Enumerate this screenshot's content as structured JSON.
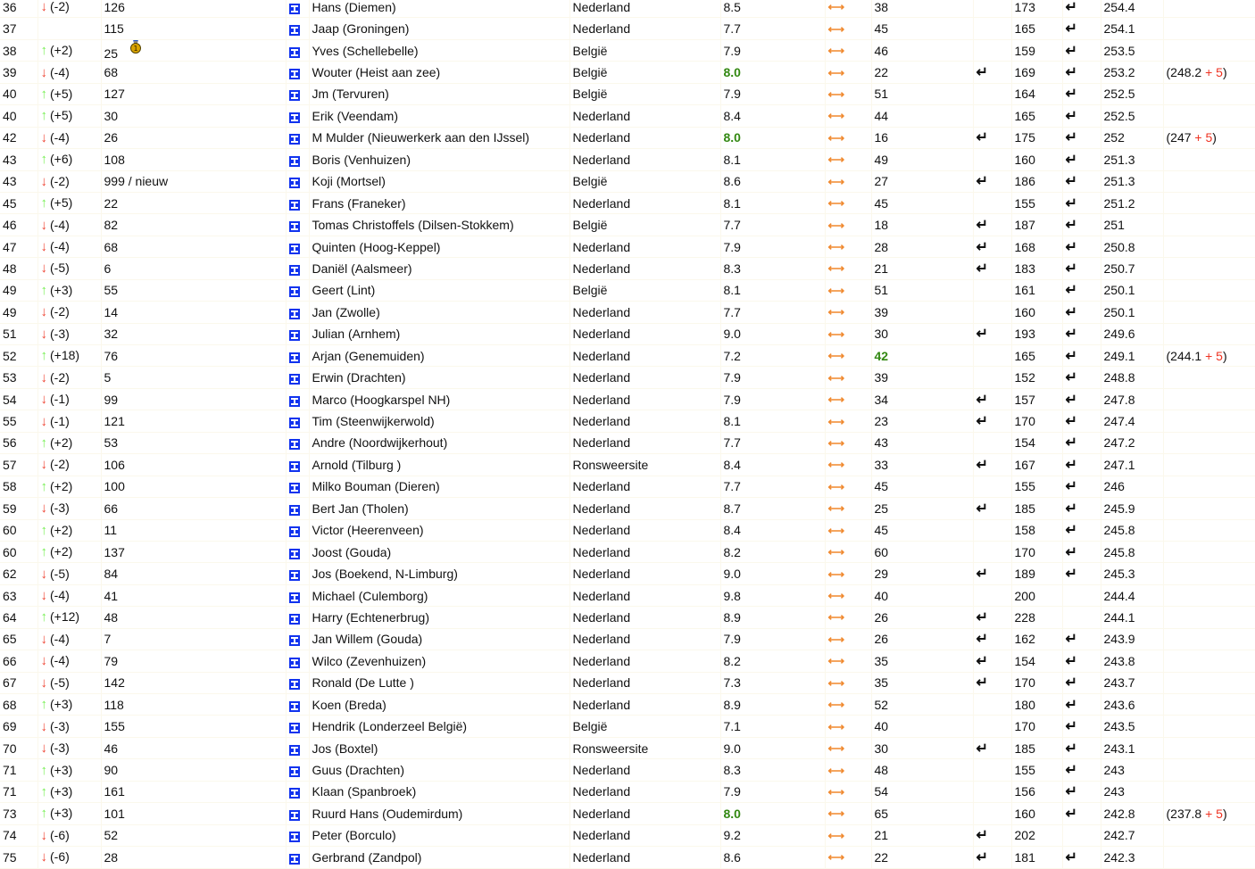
{
  "colors": {
    "down": "#ee4433",
    "up": "#77ee55",
    "green": "#338811",
    "swap": "#f08a30",
    "flag": "#1133ee"
  },
  "icons": {
    "down": "arrow-down-icon",
    "up": "arrow-up-icon",
    "flag": "player-icon",
    "swap": "swap-arrows-icon",
    "ret": "return-icon",
    "medal": "medal-icon"
  },
  "rows": [
    {
      "rank": "36",
      "dir": "down",
      "chg": "(-2)",
      "num": "126",
      "name": "Hans (Diemen)",
      "country": "Nederland",
      "score": "8.5",
      "v1": "38",
      "r1": false,
      "v2": "173",
      "r2": true,
      "total": "254.4"
    },
    {
      "rank": "37",
      "dir": "",
      "chg": "",
      "num": "115",
      "name": "Jaap (Groningen)",
      "country": "Nederland",
      "score": "7.7",
      "v1": "45",
      "r1": false,
      "v2": "165",
      "r2": true,
      "total": "254.1"
    },
    {
      "rank": "38",
      "dir": "up",
      "chg": "(+2)",
      "num": "25",
      "medal": true,
      "name": "Yves (Schellebelle)",
      "country": "België",
      "score": "7.9",
      "v1": "46",
      "r1": false,
      "v2": "159",
      "r2": true,
      "total": "253.5"
    },
    {
      "rank": "39",
      "dir": "down",
      "chg": "(-4)",
      "num": "68",
      "name": "Wouter (Heist aan zee)",
      "country": "België",
      "score": "8.0",
      "scoreGreen": true,
      "v1": "22",
      "r1": true,
      "v2": "169",
      "r2": true,
      "total": "253.2",
      "bonusBase": "248.2",
      "bonusPlus": "+ 5"
    },
    {
      "rank": "40",
      "dir": "up",
      "chg": "(+5)",
      "num": "127",
      "name": "Jm (Tervuren)",
      "country": "België",
      "score": "7.9",
      "v1": "51",
      "r1": false,
      "v2": "164",
      "r2": true,
      "total": "252.5"
    },
    {
      "rank": "40",
      "dir": "up",
      "chg": "(+5)",
      "num": "30",
      "name": "Erik (Veendam)",
      "country": "Nederland",
      "score": "8.4",
      "v1": "44",
      "r1": false,
      "v2": "165",
      "r2": true,
      "total": "252.5"
    },
    {
      "rank": "42",
      "dir": "down",
      "chg": "(-4)",
      "num": "26",
      "name": "M Mulder (Nieuwerkerk aan den IJssel)",
      "country": "Nederland",
      "score": "8.0",
      "scoreGreen": true,
      "v1": "16",
      "r1": true,
      "v2": "175",
      "r2": true,
      "total": "252",
      "bonusBase": "247",
      "bonusPlus": "+ 5"
    },
    {
      "rank": "43",
      "dir": "up",
      "chg": "(+6)",
      "num": "108",
      "name": "Boris (Venhuizen)",
      "country": "Nederland",
      "score": "8.1",
      "v1": "49",
      "r1": false,
      "v2": "160",
      "r2": true,
      "total": "251.3"
    },
    {
      "rank": "43",
      "dir": "down",
      "chg": "(-2)",
      "num": "999 / nieuw",
      "name": "Koji (Mortsel)",
      "country": "België",
      "score": "8.6",
      "v1": "27",
      "r1": true,
      "v2": "186",
      "r2": true,
      "total": "251.3"
    },
    {
      "rank": "45",
      "dir": "up",
      "chg": "(+5)",
      "num": "22",
      "name": "Frans (Franeker)",
      "country": "Nederland",
      "score": "8.1",
      "v1": "45",
      "r1": false,
      "v2": "155",
      "r2": true,
      "total": "251.2"
    },
    {
      "rank": "46",
      "dir": "down",
      "chg": "(-4)",
      "num": "82",
      "name": "Tomas Christoffels (Dilsen-Stokkem)",
      "country": "België",
      "score": "7.7",
      "v1": "18",
      "r1": true,
      "v2": "187",
      "r2": true,
      "total": "251"
    },
    {
      "rank": "47",
      "dir": "down",
      "chg": "(-4)",
      "num": "68",
      "name": "Quinten (Hoog-Keppel)",
      "country": "Nederland",
      "score": "7.9",
      "v1": "28",
      "r1": true,
      "v2": "168",
      "r2": true,
      "total": "250.8"
    },
    {
      "rank": "48",
      "dir": "down",
      "chg": "(-5)",
      "num": "6",
      "name": "Daniël (Aalsmeer)",
      "country": "Nederland",
      "score": "8.3",
      "v1": "21",
      "r1": true,
      "v2": "183",
      "r2": true,
      "total": "250.7"
    },
    {
      "rank": "49",
      "dir": "up",
      "chg": "(+3)",
      "num": "55",
      "name": "Geert (Lint)",
      "country": "België",
      "score": "8.1",
      "v1": "51",
      "r1": false,
      "v2": "161",
      "r2": true,
      "total": "250.1"
    },
    {
      "rank": "49",
      "dir": "down",
      "chg": "(-2)",
      "num": "14",
      "name": "Jan (Zwolle)",
      "country": "Nederland",
      "score": "7.7",
      "v1": "39",
      "r1": false,
      "v2": "160",
      "r2": true,
      "total": "250.1"
    },
    {
      "rank": "51",
      "dir": "down",
      "chg": "(-3)",
      "num": "32",
      "name": "Julian (Arnhem)",
      "country": "Nederland",
      "score": "9.0",
      "v1": "30",
      "r1": true,
      "v2": "193",
      "r2": true,
      "total": "249.6"
    },
    {
      "rank": "52",
      "dir": "up",
      "chg": "(+18)",
      "num": "76",
      "name": "Arjan (Genemuiden)",
      "country": "Nederland",
      "score": "7.2",
      "v1": "42",
      "v1Green": true,
      "r1": false,
      "v2": "165",
      "r2": true,
      "total": "249.1",
      "bonusBase": "244.1",
      "bonusPlus": "+ 5"
    },
    {
      "rank": "53",
      "dir": "down",
      "chg": "(-2)",
      "num": "5",
      "name": "Erwin (Drachten)",
      "country": "Nederland",
      "score": "7.9",
      "v1": "39",
      "r1": false,
      "v2": "152",
      "r2": true,
      "total": "248.8"
    },
    {
      "rank": "54",
      "dir": "down",
      "chg": "(-1)",
      "num": "99",
      "name": "Marco (Hoogkarspel NH)",
      "country": "Nederland",
      "score": "7.9",
      "v1": "34",
      "r1": true,
      "v2": "157",
      "r2": true,
      "total": "247.8"
    },
    {
      "rank": "55",
      "dir": "down",
      "chg": "(-1)",
      "num": "121",
      "name": "Tim (Steenwijkerwold)",
      "country": "Nederland",
      "score": "8.1",
      "v1": "23",
      "r1": true,
      "v2": "170",
      "r2": true,
      "total": "247.4"
    },
    {
      "rank": "56",
      "dir": "up",
      "chg": "(+2)",
      "num": "53",
      "name": "Andre (Noordwijkerhout)",
      "country": "Nederland",
      "score": "7.7",
      "v1": "43",
      "r1": false,
      "v2": "154",
      "r2": true,
      "total": "247.2"
    },
    {
      "rank": "57",
      "dir": "down",
      "chg": "(-2)",
      "num": "106",
      "name": "Arnold (Tilburg )",
      "country": "Ronsweersite",
      "score": "8.4",
      "v1": "33",
      "r1": true,
      "v2": "167",
      "r2": true,
      "total": "247.1"
    },
    {
      "rank": "58",
      "dir": "up",
      "chg": "(+2)",
      "num": "100",
      "name": "Milko Bouman (Dieren)",
      "country": "Nederland",
      "score": "7.7",
      "v1": "45",
      "r1": false,
      "v2": "155",
      "r2": true,
      "total": "246"
    },
    {
      "rank": "59",
      "dir": "down",
      "chg": "(-3)",
      "num": "66",
      "name": "Bert Jan (Tholen)",
      "country": "Nederland",
      "score": "8.7",
      "v1": "25",
      "r1": true,
      "v2": "185",
      "r2": true,
      "total": "245.9"
    },
    {
      "rank": "60",
      "dir": "up",
      "chg": "(+2)",
      "num": "11",
      "name": "Victor (Heerenveen)",
      "country": "Nederland",
      "score": "8.4",
      "v1": "45",
      "r1": false,
      "v2": "158",
      "r2": true,
      "total": "245.8"
    },
    {
      "rank": "60",
      "dir": "up",
      "chg": "(+2)",
      "num": "137",
      "name": "Joost (Gouda)",
      "country": "Nederland",
      "score": "8.2",
      "v1": "60",
      "r1": false,
      "v2": "170",
      "r2": true,
      "total": "245.8"
    },
    {
      "rank": "62",
      "dir": "down",
      "chg": "(-5)",
      "num": "84",
      "name": "Jos (Boekend, N-Limburg)",
      "country": "Nederland",
      "score": "9.0",
      "v1": "29",
      "r1": true,
      "v2": "189",
      "r2": true,
      "total": "245.3"
    },
    {
      "rank": "63",
      "dir": "down",
      "chg": "(-4)",
      "num": "41",
      "name": "Michael (Culemborg)",
      "country": "Nederland",
      "score": "9.8",
      "v1": "40",
      "r1": false,
      "v2": "200",
      "r2": false,
      "total": "244.4"
    },
    {
      "rank": "64",
      "dir": "up",
      "chg": "(+12)",
      "num": "48",
      "name": "Harry (Echtenerbrug)",
      "country": "Nederland",
      "score": "8.9",
      "v1": "26",
      "r1": true,
      "v2": "228",
      "r2": false,
      "total": "244.1"
    },
    {
      "rank": "65",
      "dir": "down",
      "chg": "(-4)",
      "num": "7",
      "name": "Jan Willem (Gouda)",
      "country": "Nederland",
      "score": "7.9",
      "v1": "26",
      "r1": true,
      "v2": "162",
      "r2": true,
      "total": "243.9"
    },
    {
      "rank": "66",
      "dir": "down",
      "chg": "(-4)",
      "num": "79",
      "name": "Wilco (Zevenhuizen)",
      "country": "Nederland",
      "score": "8.2",
      "v1": "35",
      "r1": true,
      "v2": "154",
      "r2": true,
      "total": "243.8"
    },
    {
      "rank": "67",
      "dir": "down",
      "chg": "(-5)",
      "num": "142",
      "name": "Ronald (De Lutte )",
      "country": "Nederland",
      "score": "7.3",
      "v1": "35",
      "r1": true,
      "v2": "170",
      "r2": true,
      "total": "243.7"
    },
    {
      "rank": "68",
      "dir": "up",
      "chg": "(+3)",
      "num": "118",
      "name": "Koen (Breda)",
      "country": "Nederland",
      "score": "8.9",
      "v1": "52",
      "r1": false,
      "v2": "180",
      "r2": true,
      "total": "243.6"
    },
    {
      "rank": "69",
      "dir": "down",
      "chg": "(-3)",
      "num": "155",
      "name": "Hendrik (Londerzeel België)",
      "country": "België",
      "score": "7.1",
      "v1": "40",
      "r1": false,
      "v2": "170",
      "r2": true,
      "total": "243.5"
    },
    {
      "rank": "70",
      "dir": "down",
      "chg": "(-3)",
      "num": "46",
      "name": "Jos (Boxtel)",
      "country": "Ronsweersite",
      "score": "9.0",
      "v1": "30",
      "r1": true,
      "v2": "185",
      "r2": true,
      "total": "243.1"
    },
    {
      "rank": "71",
      "dir": "up",
      "chg": "(+3)",
      "num": "90",
      "name": "Guus (Drachten)",
      "country": "Nederland",
      "score": "8.3",
      "v1": "48",
      "r1": false,
      "v2": "155",
      "r2": true,
      "total": "243"
    },
    {
      "rank": "71",
      "dir": "up",
      "chg": "(+3)",
      "num": "161",
      "name": "Klaan (Spanbroek)",
      "country": "Nederland",
      "score": "7.9",
      "v1": "54",
      "r1": false,
      "v2": "156",
      "r2": true,
      "total": "243"
    },
    {
      "rank": "73",
      "dir": "up",
      "chg": "(+3)",
      "num": "101",
      "name": "Ruurd Hans (Oudemirdum)",
      "country": "Nederland",
      "score": "8.0",
      "scoreGreen": true,
      "v1": "65",
      "r1": false,
      "v2": "160",
      "r2": true,
      "total": "242.8",
      "bonusBase": "237.8",
      "bonusPlus": "+ 5"
    },
    {
      "rank": "74",
      "dir": "down",
      "chg": "(-6)",
      "num": "52",
      "name": "Peter (Borculo)",
      "country": "Nederland",
      "score": "9.2",
      "v1": "21",
      "r1": true,
      "v2": "202",
      "r2": false,
      "total": "242.7"
    },
    {
      "rank": "75",
      "dir": "down",
      "chg": "(-6)",
      "num": "28",
      "name": "Gerbrand (Zandpol)",
      "country": "Nederland",
      "score": "8.6",
      "v1": "22",
      "r1": true,
      "v2": "181",
      "r2": true,
      "total": "242.3"
    }
  ]
}
